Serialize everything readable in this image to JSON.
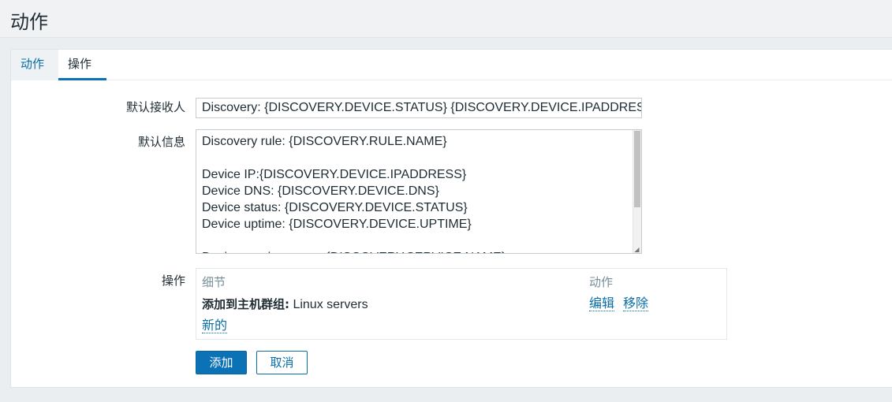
{
  "header": {
    "title": "动作"
  },
  "tabs": [
    {
      "label": "动作"
    },
    {
      "label": "操作"
    }
  ],
  "form": {
    "default_recipient": {
      "label": "默认接收人",
      "value": "Discovery: {DISCOVERY.DEVICE.STATUS} {DISCOVERY.DEVICE.IPADDRESS}"
    },
    "default_message": {
      "label": "默认信息",
      "value": "Discovery rule: {DISCOVERY.RULE.NAME}\n\nDevice IP:{DISCOVERY.DEVICE.IPADDRESS}\nDevice DNS: {DISCOVERY.DEVICE.DNS}\nDevice status: {DISCOVERY.DEVICE.STATUS}\nDevice uptime: {DISCOVERY.DEVICE.UPTIME}\n\nDevice service name: {DISCOVERY.SERVICE.NAME}"
    },
    "operations": {
      "label": "操作",
      "columns": {
        "details": "细节",
        "action": "动作"
      },
      "rows": [
        {
          "detail_prefix": "添加到主机群组:",
          "detail_value": " Linux servers",
          "edit_label": "编辑",
          "remove_label": "移除"
        }
      ],
      "new_label": "新的"
    }
  },
  "buttons": {
    "add": "添加",
    "cancel": "取消"
  },
  "colors": {
    "accent": "#0b72b5",
    "link": "#0a6ea6",
    "background": "#ebeef0"
  }
}
